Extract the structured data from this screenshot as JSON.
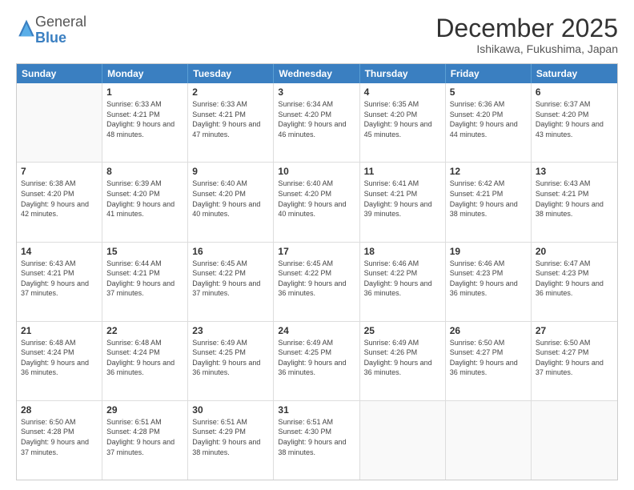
{
  "header": {
    "logo_general": "General",
    "logo_blue": "Blue",
    "month_year": "December 2025",
    "location": "Ishikawa, Fukushima, Japan"
  },
  "weekdays": [
    "Sunday",
    "Monday",
    "Tuesday",
    "Wednesday",
    "Thursday",
    "Friday",
    "Saturday"
  ],
  "rows": [
    [
      {
        "day": "",
        "empty": true
      },
      {
        "day": "1",
        "sunrise": "Sunrise: 6:33 AM",
        "sunset": "Sunset: 4:21 PM",
        "daylight": "Daylight: 9 hours and 48 minutes."
      },
      {
        "day": "2",
        "sunrise": "Sunrise: 6:33 AM",
        "sunset": "Sunset: 4:21 PM",
        "daylight": "Daylight: 9 hours and 47 minutes."
      },
      {
        "day": "3",
        "sunrise": "Sunrise: 6:34 AM",
        "sunset": "Sunset: 4:20 PM",
        "daylight": "Daylight: 9 hours and 46 minutes."
      },
      {
        "day": "4",
        "sunrise": "Sunrise: 6:35 AM",
        "sunset": "Sunset: 4:20 PM",
        "daylight": "Daylight: 9 hours and 45 minutes."
      },
      {
        "day": "5",
        "sunrise": "Sunrise: 6:36 AM",
        "sunset": "Sunset: 4:20 PM",
        "daylight": "Daylight: 9 hours and 44 minutes."
      },
      {
        "day": "6",
        "sunrise": "Sunrise: 6:37 AM",
        "sunset": "Sunset: 4:20 PM",
        "daylight": "Daylight: 9 hours and 43 minutes."
      }
    ],
    [
      {
        "day": "7",
        "sunrise": "Sunrise: 6:38 AM",
        "sunset": "Sunset: 4:20 PM",
        "daylight": "Daylight: 9 hours and 42 minutes."
      },
      {
        "day": "8",
        "sunrise": "Sunrise: 6:39 AM",
        "sunset": "Sunset: 4:20 PM",
        "daylight": "Daylight: 9 hours and 41 minutes."
      },
      {
        "day": "9",
        "sunrise": "Sunrise: 6:40 AM",
        "sunset": "Sunset: 4:20 PM",
        "daylight": "Daylight: 9 hours and 40 minutes."
      },
      {
        "day": "10",
        "sunrise": "Sunrise: 6:40 AM",
        "sunset": "Sunset: 4:20 PM",
        "daylight": "Daylight: 9 hours and 40 minutes."
      },
      {
        "day": "11",
        "sunrise": "Sunrise: 6:41 AM",
        "sunset": "Sunset: 4:21 PM",
        "daylight": "Daylight: 9 hours and 39 minutes."
      },
      {
        "day": "12",
        "sunrise": "Sunrise: 6:42 AM",
        "sunset": "Sunset: 4:21 PM",
        "daylight": "Daylight: 9 hours and 38 minutes."
      },
      {
        "day": "13",
        "sunrise": "Sunrise: 6:43 AM",
        "sunset": "Sunset: 4:21 PM",
        "daylight": "Daylight: 9 hours and 38 minutes."
      }
    ],
    [
      {
        "day": "14",
        "sunrise": "Sunrise: 6:43 AM",
        "sunset": "Sunset: 4:21 PM",
        "daylight": "Daylight: 9 hours and 37 minutes."
      },
      {
        "day": "15",
        "sunrise": "Sunrise: 6:44 AM",
        "sunset": "Sunset: 4:21 PM",
        "daylight": "Daylight: 9 hours and 37 minutes."
      },
      {
        "day": "16",
        "sunrise": "Sunrise: 6:45 AM",
        "sunset": "Sunset: 4:22 PM",
        "daylight": "Daylight: 9 hours and 37 minutes."
      },
      {
        "day": "17",
        "sunrise": "Sunrise: 6:45 AM",
        "sunset": "Sunset: 4:22 PM",
        "daylight": "Daylight: 9 hours and 36 minutes."
      },
      {
        "day": "18",
        "sunrise": "Sunrise: 6:46 AM",
        "sunset": "Sunset: 4:22 PM",
        "daylight": "Daylight: 9 hours and 36 minutes."
      },
      {
        "day": "19",
        "sunrise": "Sunrise: 6:46 AM",
        "sunset": "Sunset: 4:23 PM",
        "daylight": "Daylight: 9 hours and 36 minutes."
      },
      {
        "day": "20",
        "sunrise": "Sunrise: 6:47 AM",
        "sunset": "Sunset: 4:23 PM",
        "daylight": "Daylight: 9 hours and 36 minutes."
      }
    ],
    [
      {
        "day": "21",
        "sunrise": "Sunrise: 6:48 AM",
        "sunset": "Sunset: 4:24 PM",
        "daylight": "Daylight: 9 hours and 36 minutes."
      },
      {
        "day": "22",
        "sunrise": "Sunrise: 6:48 AM",
        "sunset": "Sunset: 4:24 PM",
        "daylight": "Daylight: 9 hours and 36 minutes."
      },
      {
        "day": "23",
        "sunrise": "Sunrise: 6:49 AM",
        "sunset": "Sunset: 4:25 PM",
        "daylight": "Daylight: 9 hours and 36 minutes."
      },
      {
        "day": "24",
        "sunrise": "Sunrise: 6:49 AM",
        "sunset": "Sunset: 4:25 PM",
        "daylight": "Daylight: 9 hours and 36 minutes."
      },
      {
        "day": "25",
        "sunrise": "Sunrise: 6:49 AM",
        "sunset": "Sunset: 4:26 PM",
        "daylight": "Daylight: 9 hours and 36 minutes."
      },
      {
        "day": "26",
        "sunrise": "Sunrise: 6:50 AM",
        "sunset": "Sunset: 4:27 PM",
        "daylight": "Daylight: 9 hours and 36 minutes."
      },
      {
        "day": "27",
        "sunrise": "Sunrise: 6:50 AM",
        "sunset": "Sunset: 4:27 PM",
        "daylight": "Daylight: 9 hours and 37 minutes."
      }
    ],
    [
      {
        "day": "28",
        "sunrise": "Sunrise: 6:50 AM",
        "sunset": "Sunset: 4:28 PM",
        "daylight": "Daylight: 9 hours and 37 minutes."
      },
      {
        "day": "29",
        "sunrise": "Sunrise: 6:51 AM",
        "sunset": "Sunset: 4:28 PM",
        "daylight": "Daylight: 9 hours and 37 minutes."
      },
      {
        "day": "30",
        "sunrise": "Sunrise: 6:51 AM",
        "sunset": "Sunset: 4:29 PM",
        "daylight": "Daylight: 9 hours and 38 minutes."
      },
      {
        "day": "31",
        "sunrise": "Sunrise: 6:51 AM",
        "sunset": "Sunset: 4:30 PM",
        "daylight": "Daylight: 9 hours and 38 minutes."
      },
      {
        "day": "",
        "empty": true
      },
      {
        "day": "",
        "empty": true
      },
      {
        "day": "",
        "empty": true
      }
    ]
  ]
}
